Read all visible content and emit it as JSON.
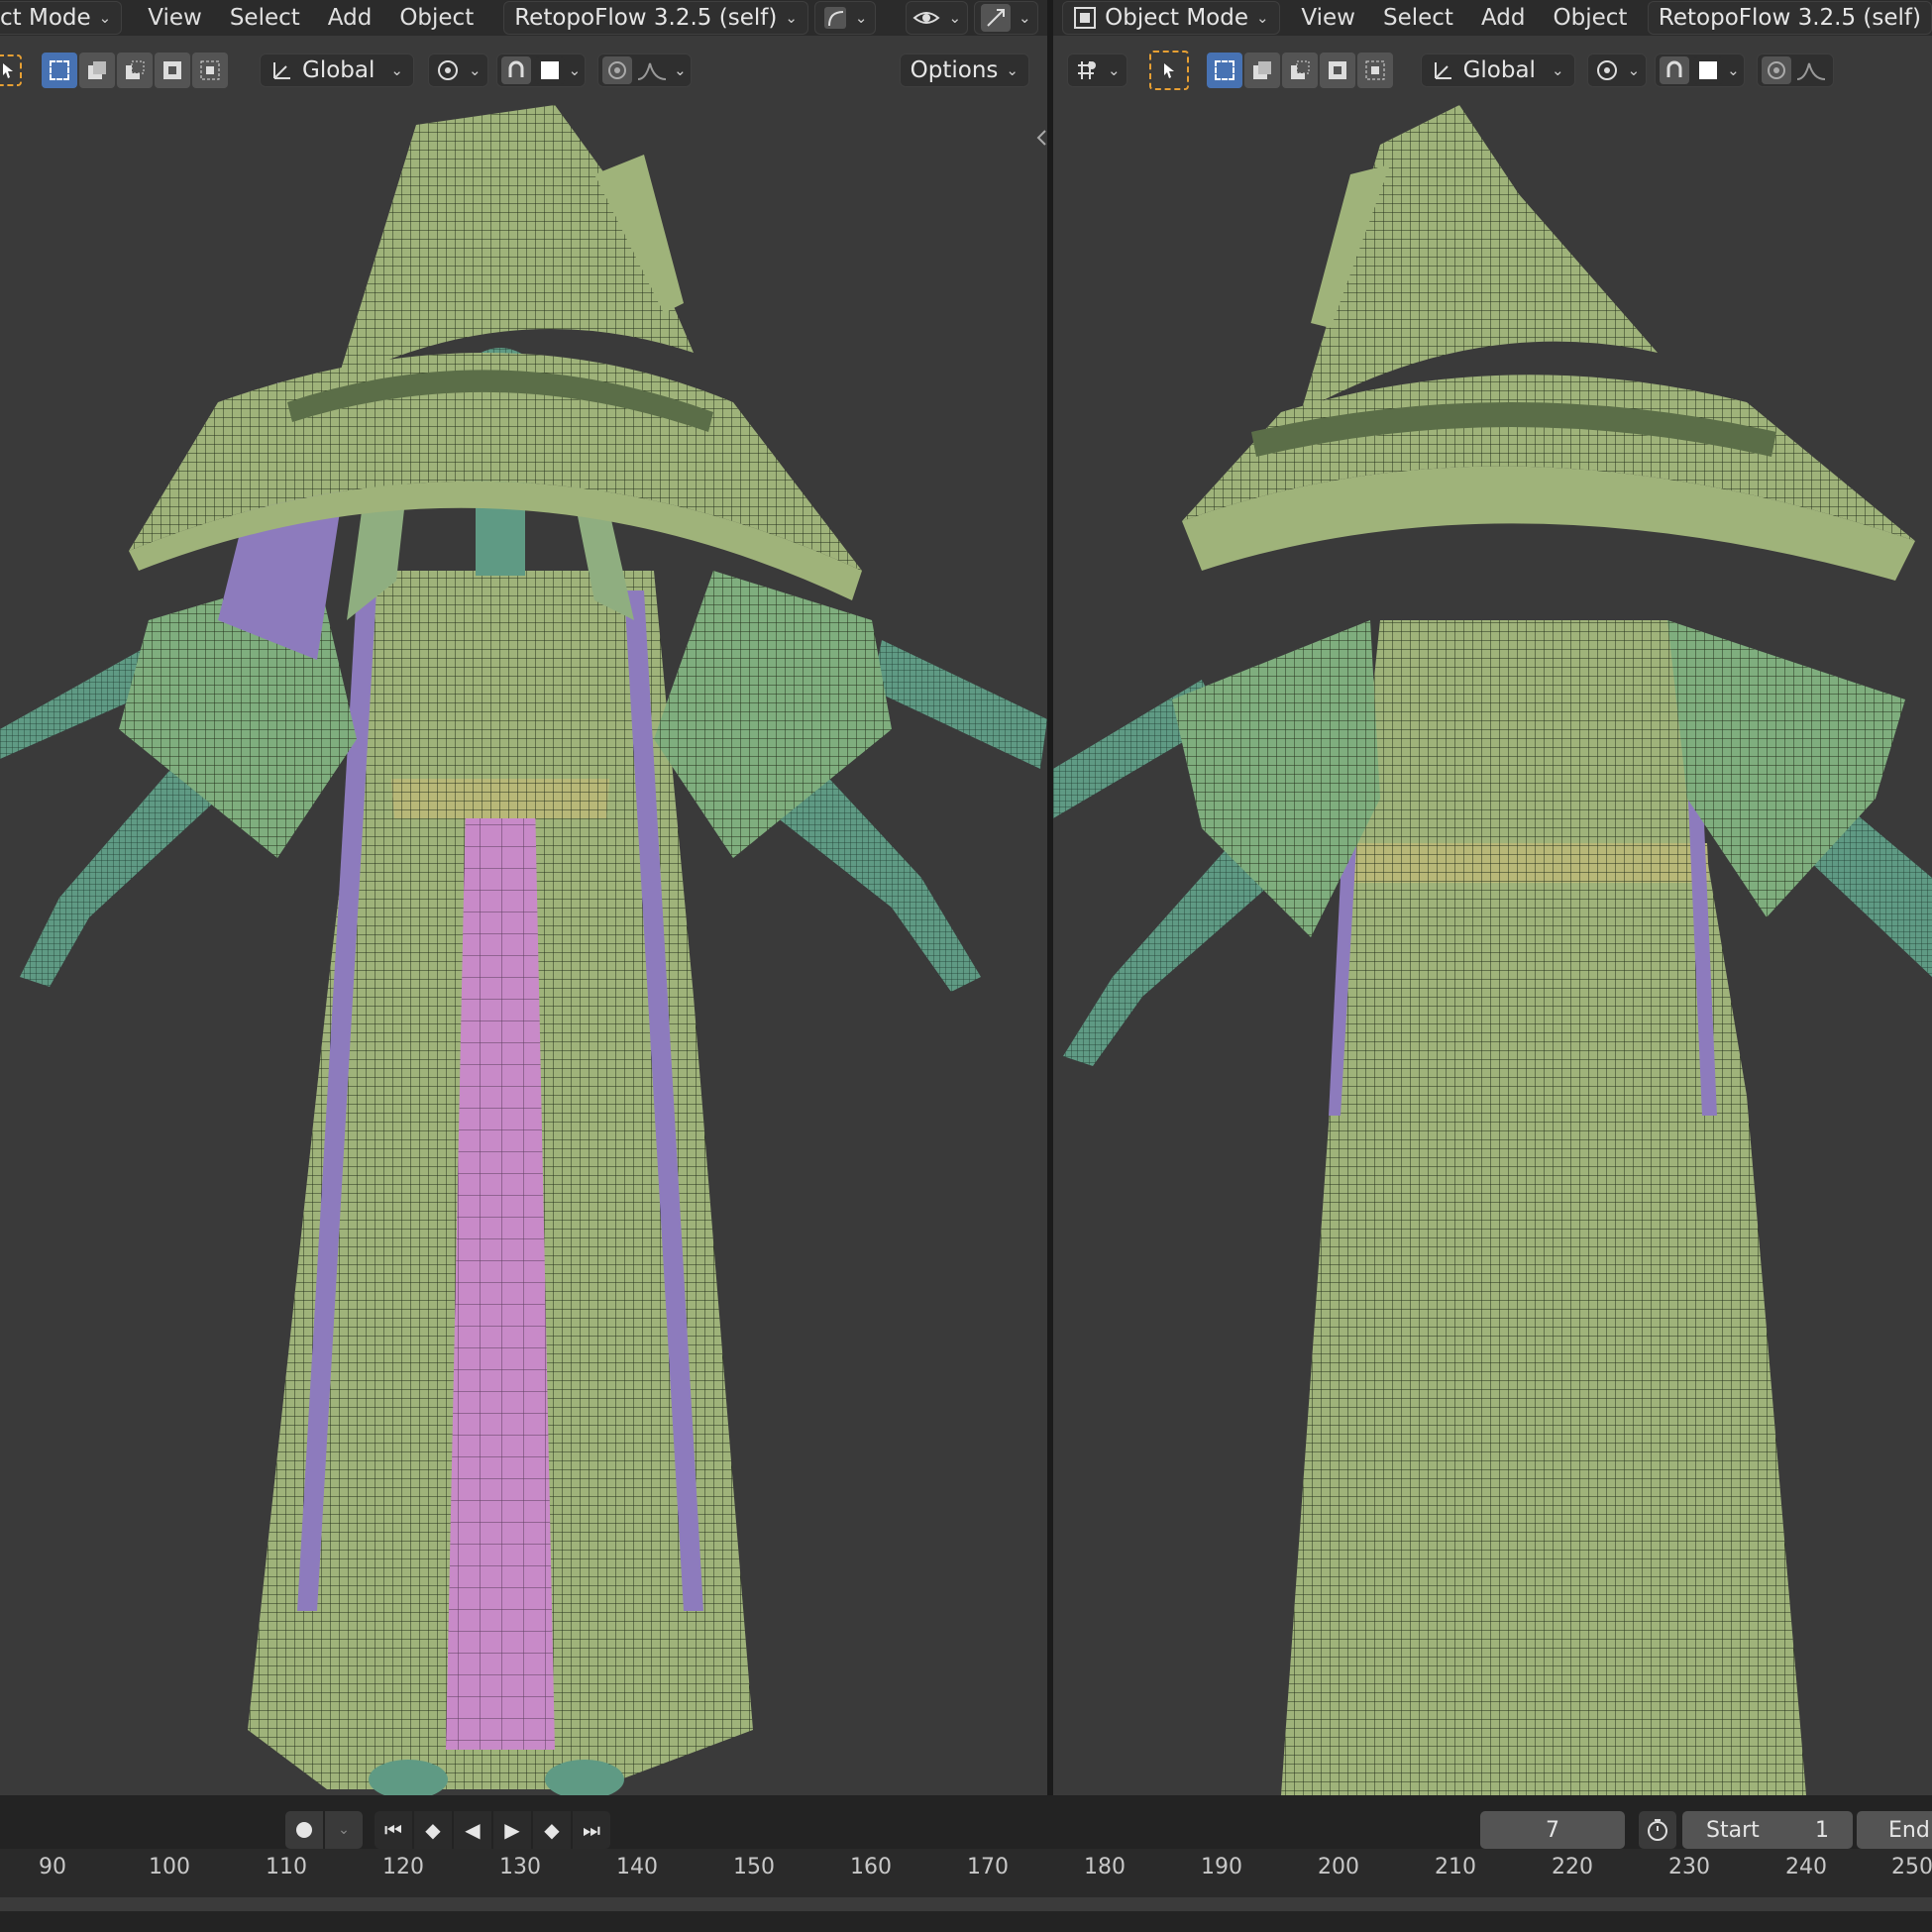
{
  "left_header": {
    "mode_label": "ct Mode",
    "menus": [
      "View",
      "Select",
      "Add",
      "Object"
    ],
    "addon_label": "RetopoFlow 3.2.5 (self)"
  },
  "right_header": {
    "mode_label": "Object Mode",
    "menus": [
      "View",
      "Select",
      "Add",
      "Object"
    ],
    "addon_label": "RetopoFlow 3.2.5 (self)"
  },
  "left_tools": {
    "orientation": "Global",
    "options_label": "Options"
  },
  "right_tools": {
    "orientation": "Global"
  },
  "timeline": {
    "current_frame": "7",
    "start_label": "Start",
    "start_value": "1",
    "end_label": "End",
    "ticks": [
      "90",
      "100",
      "110",
      "120",
      "130",
      "140",
      "150",
      "160",
      "170",
      "180",
      "190",
      "200",
      "210",
      "220",
      "230",
      "240",
      "250"
    ]
  },
  "colors": {
    "viewport_bg": "#3a3a3a",
    "header_bg": "#2b2b2b",
    "accent_blue": "#4772b3",
    "select_orange": "#e8a033",
    "robe_green": "#9fb37a",
    "skin_teal": "#5f9a84",
    "lining_pink": "#c88ac8",
    "trim_purple": "#8d7bbd"
  },
  "icons": [
    "eye-icon",
    "gizmo-icon",
    "snap-icon",
    "proportional-icon",
    "play-icon",
    "record-icon",
    "stopwatch-icon"
  ]
}
